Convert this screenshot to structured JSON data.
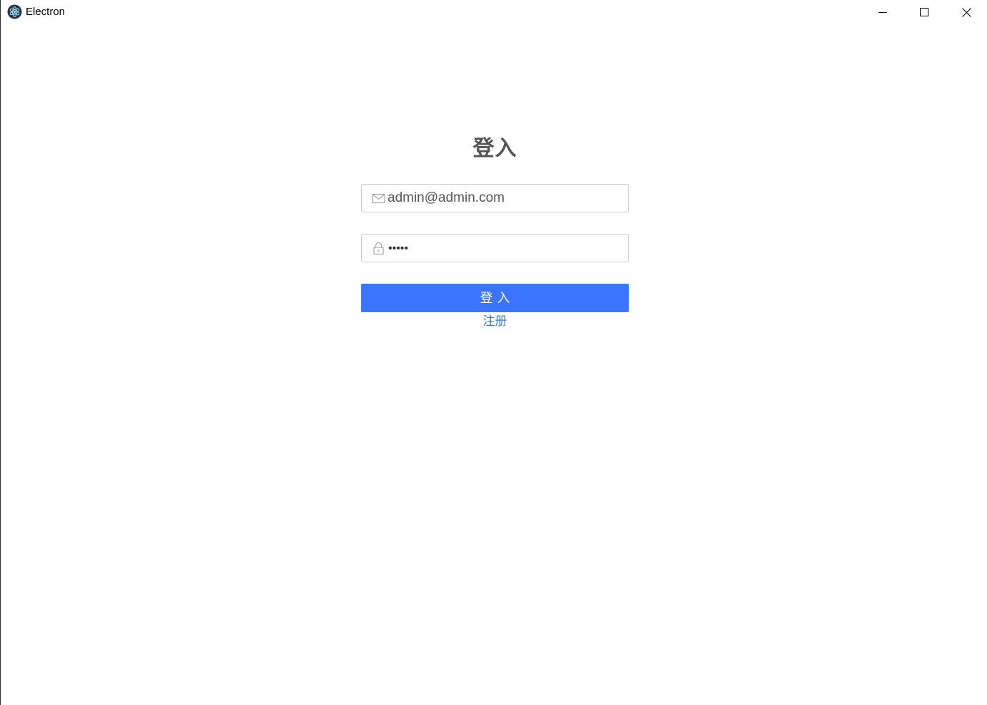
{
  "window": {
    "title": "Electron",
    "icon": "electron-logo-icon",
    "controls": {
      "minimize": "minimize-icon",
      "maximize": "maximize-icon",
      "close": "close-icon"
    }
  },
  "login": {
    "title": "登入",
    "email": {
      "icon": "mail-icon",
      "value": "admin@admin.com"
    },
    "password": {
      "icon": "lock-icon",
      "masked_value": "•••••"
    },
    "submit_label": "登入",
    "register_label": "注册"
  },
  "colors": {
    "primary": "#3b74ff",
    "title_text": "#555555",
    "border": "#cfcfcf"
  }
}
